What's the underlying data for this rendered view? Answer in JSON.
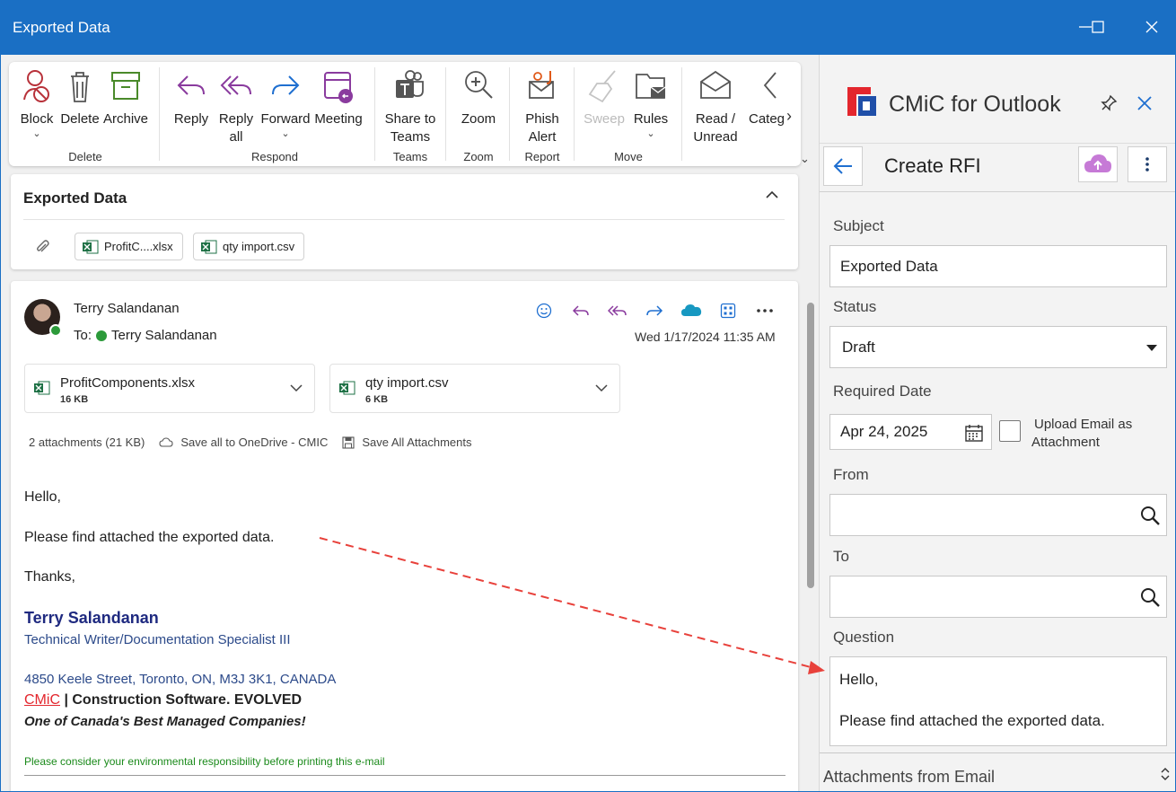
{
  "window": {
    "title": "Exported Data"
  },
  "ribbon": {
    "buttons": {
      "block": "Block",
      "delete": "Delete",
      "archive": "Archive",
      "reply": "Reply",
      "reply_all_1": "Reply",
      "reply_all_2": "all",
      "forward": "Forward",
      "meeting": "Meeting",
      "share_1": "Share to",
      "share_2": "Teams",
      "zoom": "Zoom",
      "phish_1": "Phish",
      "phish_2": "Alert",
      "sweep": "Sweep",
      "rules": "Rules",
      "read_1": "Read /",
      "read_2": "Unread",
      "categ": "Categ"
    },
    "groups": {
      "delete": "Delete",
      "respond": "Respond",
      "teams": "Teams",
      "zoom": "Zoom",
      "report": "Report",
      "move": "Move"
    }
  },
  "subject_card": {
    "subject": "Exported Data",
    "attachments": [
      "ProfitC....xlsx",
      "qty import.csv"
    ]
  },
  "message": {
    "sender": "Terry Salandanan",
    "to_label": "To:",
    "to": "Terry Salandanan",
    "date": "Wed 1/17/2024 11:35 AM",
    "attachments": [
      {
        "name": "ProfitComponents.xlsx",
        "size": "16 KB"
      },
      {
        "name": "qty import.csv",
        "size": "6 KB"
      }
    ],
    "attachment_summary": "2 attachments (21 KB)",
    "save_onedrive": "Save all to OneDrive - CMIC",
    "save_all": "Save All Attachments",
    "body": {
      "greeting": "Hello,",
      "line1": "Please find attached the exported data.",
      "thanks": "Thanks,"
    },
    "signature": {
      "name": "Terry Salandanan",
      "role": "Technical Writer/Documentation Specialist III",
      "address": "4850 Keele Street, Toronto, ON, M3J 3K1, CANADA",
      "company_brand": "CMiC",
      "company_sep": " | ",
      "company_tag": "Construction Software. EVOLVED",
      "tagline": "One of Canada's Best Managed Companies!",
      "env": "Please consider your environmental responsibility before printing this e-mail"
    }
  },
  "pane": {
    "app_name": "CMiC for Outlook",
    "title": "Create RFI",
    "labels": {
      "subject": "Subject",
      "status": "Status",
      "required_date": "Required Date",
      "upload_1": "Upload Email as",
      "upload_2": "Attachment",
      "from": "From",
      "to": "To",
      "question": "Question"
    },
    "values": {
      "subject": "Exported Data",
      "status": "Draft",
      "required_date": "Apr 24, 2025",
      "from": "",
      "to": "",
      "question_1": "Hello,",
      "question_2": "Please find attached the exported data."
    },
    "upload_checked": false,
    "accordion": "Attachments from Email"
  },
  "colors": {
    "titlebar": "#1a6fc4",
    "accent_purple": "#8a3b9e",
    "accent_blue": "#1f6fd0",
    "brand_red": "#e3262d"
  }
}
